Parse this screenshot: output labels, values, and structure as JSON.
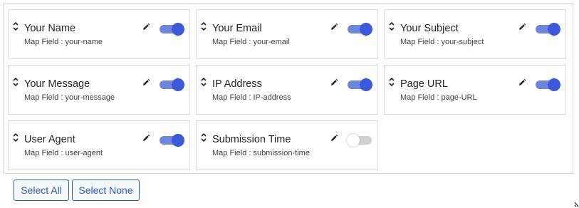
{
  "fields": [
    {
      "title": "Your Name",
      "map_label": "Map Field : your-name",
      "enabled": true
    },
    {
      "title": "Your Email",
      "map_label": "Map Field : your-email",
      "enabled": true
    },
    {
      "title": "Your Subject",
      "map_label": "Map Field : your-subject",
      "enabled": true
    },
    {
      "title": "Your Message",
      "map_label": "Map Field : your-message",
      "enabled": true
    },
    {
      "title": "IP Address",
      "map_label": "Map Field : IP-address",
      "enabled": true
    },
    {
      "title": "Page URL",
      "map_label": "Map Field : page-URL",
      "enabled": true
    },
    {
      "title": "User Agent",
      "map_label": "Map Field : user-agent",
      "enabled": true
    },
    {
      "title": "Submission Time",
      "map_label": "Map Field : submission-time",
      "enabled": false
    }
  ],
  "actions": {
    "select_all": "Select All",
    "select_none": "Select None"
  },
  "colors": {
    "accent": "#3a5ad9",
    "toggle_track_on": "#6d86e2",
    "button_text": "#2c5bc0"
  }
}
